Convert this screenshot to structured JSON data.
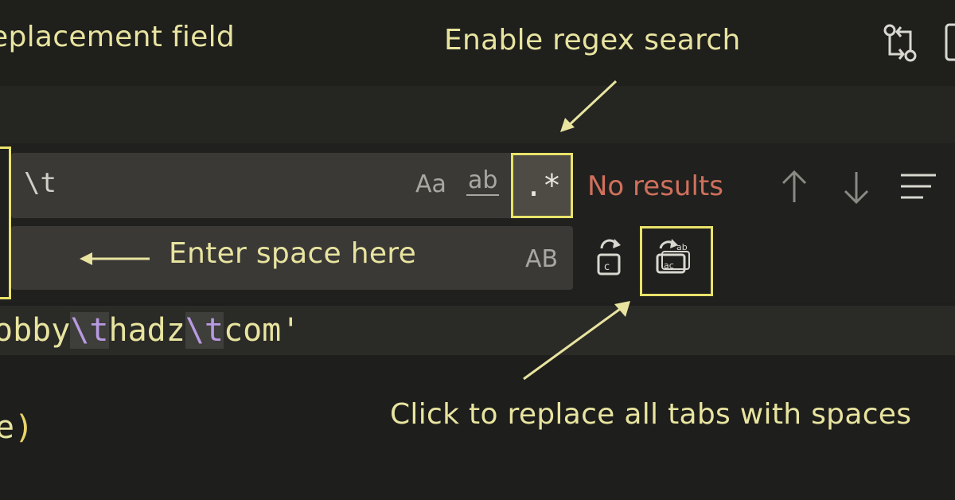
{
  "annotations": {
    "replacement_field": "eplacement field",
    "enable_regex": "Enable regex search",
    "enter_space": "Enter space here",
    "replace_all_tabs": "Click to replace all tabs with spaces"
  },
  "find_widget": {
    "find_value": "\\t",
    "match_case_label": "Aa",
    "whole_word_label": "ab",
    "regex_label": ".*",
    "status_text": "No results",
    "preserve_case_label": "AB",
    "replace_value": ""
  },
  "icons": {
    "toolbar": [
      "compare-changes-icon",
      "split-editor-icon"
    ],
    "find": [
      "arrow-up-icon",
      "arrow-down-icon",
      "find-in-selection-icon"
    ],
    "replace": [
      "replace-icon",
      "replace-all-icon"
    ]
  },
  "code": {
    "line1": [
      {
        "text": "obby",
        "type": "str"
      },
      {
        "text": "\\t",
        "type": "esc"
      },
      {
        "text": "hadz",
        "type": "str"
      },
      {
        "text": "\\t",
        "type": "esc"
      },
      {
        "text": "com'",
        "type": "str"
      }
    ],
    "line2": [
      {
        "text": "e",
        "type": "str"
      },
      {
        "text": ")",
        "type": "paren"
      }
    ]
  },
  "colors": {
    "annotation": "#e8e4a0",
    "highlight_box": "#e9e36a",
    "no_results": "#d0705c",
    "escape": "#b79ae0"
  }
}
